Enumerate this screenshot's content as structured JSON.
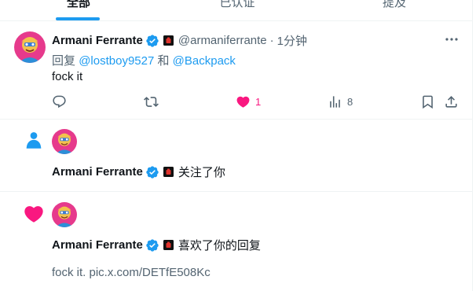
{
  "tabs": [
    {
      "label": "全部",
      "active": true
    },
    {
      "label": "已认证",
      "active": false
    },
    {
      "label": "提及",
      "active": false
    }
  ],
  "colors": {
    "accent": "#1d9bf0",
    "like": "#f91880",
    "muted": "#536471"
  },
  "tweet": {
    "name": "Armani Ferrante",
    "handle": "@armaniferrante",
    "dot": "·",
    "time": "1分钟",
    "reply_prefix": "回复",
    "reply_to_1": "@lostboy9527",
    "reply_and": "和",
    "reply_to_2": "@Backpack",
    "text": "fock it",
    "likes": "1",
    "views": "8",
    "icons": [
      "reply-icon",
      "retweet-icon",
      "heart-icon",
      "views-icon",
      "bookmark-icon",
      "share-icon",
      "more-icon"
    ]
  },
  "follow_notification": {
    "name": "Armani Ferrante",
    "action": "关注了你",
    "icon": "person-icon"
  },
  "like_notification": {
    "name": "Armani Ferrante",
    "action": "喜欢了你的回复",
    "preview": "fock it. pic.x.com/DETfE508Kc",
    "icon": "heart-icon"
  }
}
